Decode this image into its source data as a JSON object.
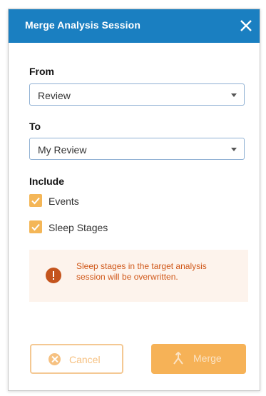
{
  "dialog": {
    "title": "Merge Analysis Session",
    "close_icon": "close-icon"
  },
  "from": {
    "label": "From",
    "selected": "Review"
  },
  "to": {
    "label": "To",
    "selected": "My Review"
  },
  "include": {
    "label": "Include",
    "options": [
      {
        "label": "Events",
        "checked": true
      },
      {
        "label": "Sleep Stages",
        "checked": true
      }
    ]
  },
  "warning": {
    "icon": "exclamation-circle-icon",
    "text": "Sleep stages in the target analysis session will be overwritten."
  },
  "buttons": {
    "cancel_label": "Cancel",
    "cancel_icon": "cancel-circle-icon",
    "merge_label": "Merge",
    "merge_icon": "merge-icon",
    "disabled": true
  },
  "colors": {
    "header": "#1a7fc1",
    "accent": "#f6b257",
    "warning_text": "#d0591b",
    "warning_bg": "#fdf3ec"
  }
}
